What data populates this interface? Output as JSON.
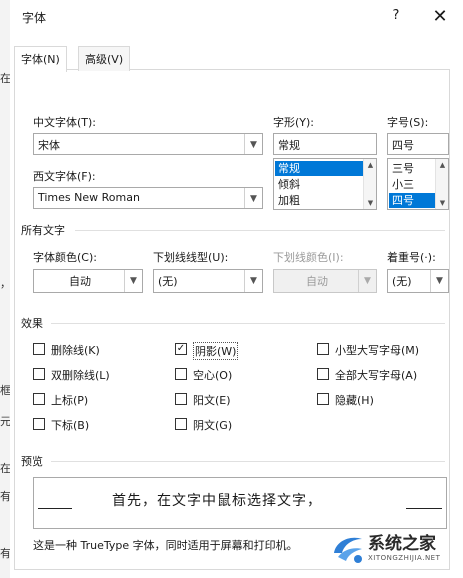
{
  "dialog": {
    "title": "字体",
    "help_label": "?",
    "close_label": "✕"
  },
  "tabs": [
    {
      "label": "字体(N)"
    },
    {
      "label": "高级(V)"
    }
  ],
  "fields": {
    "chinese_font": {
      "label": "中文字体(T):",
      "value": "宋体"
    },
    "western_font": {
      "label": "西文字体(F):",
      "value": "Times New Roman"
    },
    "style": {
      "label": "字形(Y):",
      "value": "常规",
      "options": [
        "常规",
        "倾斜",
        "加粗"
      ],
      "selected": "常规"
    },
    "size": {
      "label": "字号(S):",
      "value": "四号",
      "options": [
        "三号",
        "小三",
        "四号"
      ],
      "selected": "四号"
    }
  },
  "all_text": {
    "section_title": "所有文字",
    "font_color": {
      "label": "字体颜色(C):",
      "value": "自动"
    },
    "underline_style": {
      "label": "下划线线型(U):",
      "value": "(无)"
    },
    "underline_color": {
      "label": "下划线颜色(I):",
      "value": "自动"
    },
    "emphasis": {
      "label": "着重号(·):",
      "value": "(无)"
    }
  },
  "effects": {
    "section_title": "效果",
    "items": [
      {
        "label": "删除线(K)",
        "checked": false
      },
      {
        "label": "双删除线(L)",
        "checked": false
      },
      {
        "label": "上标(P)",
        "checked": false
      },
      {
        "label": "下标(B)",
        "checked": false
      },
      {
        "label": "阴影(W)",
        "checked": true
      },
      {
        "label": "空心(O)",
        "checked": false
      },
      {
        "label": "阳文(E)",
        "checked": false
      },
      {
        "label": "阴文(G)",
        "checked": false
      },
      {
        "label": "小型大写字母(M)",
        "checked": false
      },
      {
        "label": "全部大写字母(A)",
        "checked": false
      },
      {
        "label": "隐藏(H)",
        "checked": false
      }
    ]
  },
  "preview": {
    "section_title": "预览",
    "text": "首先，在文字中鼠标选择文字，",
    "note": "这是一种 TrueType 字体，同时适用于屏幕和打印机。"
  },
  "left_clipped": [
    "在",
    "，",
    "框",
    "元",
    "在",
    "有",
    "有"
  ],
  "watermark": {
    "text": "系统之家",
    "url": "XITONGZHIJIA.NET"
  },
  "colors": {
    "selection": "#0078d7",
    "border": "#a9a9a9",
    "disabled": "#9a9a9a"
  }
}
